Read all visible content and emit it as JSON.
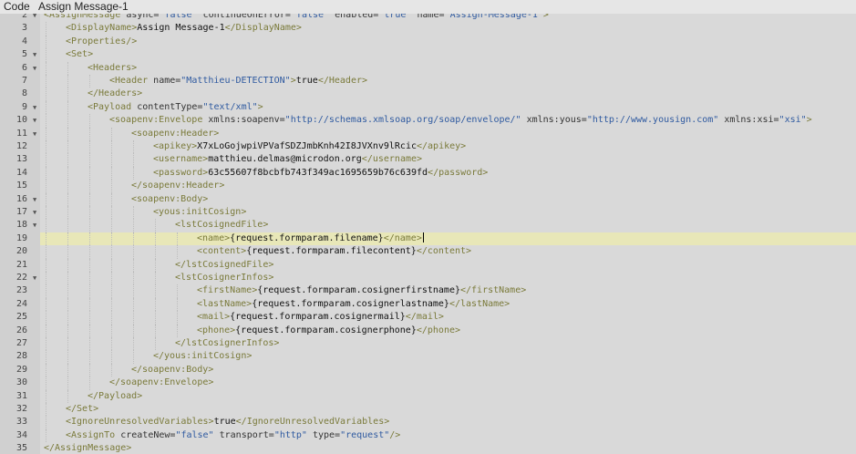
{
  "header": {
    "code_label": "Code",
    "policy_name": "Assign Message-1"
  },
  "editor": {
    "active_line": 19,
    "lines": [
      {
        "n": "2",
        "fold": true,
        "indent": 0,
        "tokens": [
          [
            "tag",
            "<AssignMessage "
          ],
          [
            "attr",
            "async="
          ],
          [
            "str",
            "\"false\""
          ],
          [
            "attr",
            " continueOnError="
          ],
          [
            "str",
            "\"false\""
          ],
          [
            "attr",
            " enabled="
          ],
          [
            "str",
            "\"true\""
          ],
          [
            "attr",
            " name="
          ],
          [
            "str",
            "\"Assign-Message-1\""
          ],
          [
            "tag",
            ">"
          ]
        ]
      },
      {
        "n": "3",
        "fold": false,
        "indent": 1,
        "tokens": [
          [
            "tag",
            "<DisplayName>"
          ],
          [
            "txt",
            "Assign Message-1"
          ],
          [
            "tag",
            "</DisplayName>"
          ]
        ]
      },
      {
        "n": "4",
        "fold": false,
        "indent": 1,
        "tokens": [
          [
            "tag",
            "<Properties/>"
          ]
        ]
      },
      {
        "n": "5",
        "fold": true,
        "indent": 1,
        "tokens": [
          [
            "tag",
            "<Set>"
          ]
        ]
      },
      {
        "n": "6",
        "fold": true,
        "indent": 2,
        "tokens": [
          [
            "tag",
            "<Headers>"
          ]
        ]
      },
      {
        "n": "7",
        "fold": false,
        "indent": 3,
        "tokens": [
          [
            "tag",
            "<Header "
          ],
          [
            "attr",
            "name="
          ],
          [
            "str",
            "\"Matthieu-DETECTION\""
          ],
          [
            "tag",
            ">"
          ],
          [
            "txt",
            "true"
          ],
          [
            "tag",
            "</Header>"
          ]
        ]
      },
      {
        "n": "8",
        "fold": false,
        "indent": 2,
        "tokens": [
          [
            "tag",
            "</Headers>"
          ]
        ]
      },
      {
        "n": "9",
        "fold": true,
        "indent": 2,
        "tokens": [
          [
            "tag",
            "<Payload "
          ],
          [
            "attr",
            "contentType="
          ],
          [
            "str",
            "\"text/xml\""
          ],
          [
            "tag",
            ">"
          ]
        ]
      },
      {
        "n": "10",
        "fold": true,
        "indent": 3,
        "tokens": [
          [
            "tag",
            "<soapenv:Envelope "
          ],
          [
            "attr",
            "xmlns:soapenv="
          ],
          [
            "str",
            "\"http://schemas.xmlsoap.org/soap/envelope/\""
          ],
          [
            "attr",
            " xmlns:yous="
          ],
          [
            "str",
            "\"http://www.yousign.com\""
          ],
          [
            "attr",
            " xmlns:xsi="
          ],
          [
            "str",
            "\"xsi\""
          ],
          [
            "tag",
            ">"
          ]
        ]
      },
      {
        "n": "11",
        "fold": true,
        "indent": 4,
        "tokens": [
          [
            "tag",
            "<soapenv:Header>"
          ]
        ]
      },
      {
        "n": "12",
        "fold": false,
        "indent": 5,
        "tokens": [
          [
            "tag",
            "<apikey>"
          ],
          [
            "txt",
            "X7xLoGojwpiVPVafSDZJmbKnh42I8JVXnv9lRcic"
          ],
          [
            "tag",
            "</apikey>"
          ]
        ]
      },
      {
        "n": "13",
        "fold": false,
        "indent": 5,
        "tokens": [
          [
            "tag",
            "<username>"
          ],
          [
            "txt",
            "matthieu.delmas@microdon.org"
          ],
          [
            "tag",
            "</username>"
          ]
        ]
      },
      {
        "n": "14",
        "fold": false,
        "indent": 5,
        "tokens": [
          [
            "tag",
            "<password>"
          ],
          [
            "txt",
            "63c55607f8bcbfb743f349ac1695659b76c639fd"
          ],
          [
            "tag",
            "</password>"
          ]
        ]
      },
      {
        "n": "15",
        "fold": false,
        "indent": 4,
        "tokens": [
          [
            "tag",
            "</soapenv:Header>"
          ]
        ]
      },
      {
        "n": "16",
        "fold": true,
        "indent": 4,
        "tokens": [
          [
            "tag",
            "<soapenv:Body>"
          ]
        ]
      },
      {
        "n": "17",
        "fold": true,
        "indent": 5,
        "tokens": [
          [
            "tag",
            "<yous:initCosign>"
          ]
        ]
      },
      {
        "n": "18",
        "fold": true,
        "indent": 6,
        "tokens": [
          [
            "tag",
            "<lstCosignedFile>"
          ]
        ]
      },
      {
        "n": "19",
        "fold": false,
        "indent": 7,
        "tokens": [
          [
            "tag",
            "<name>"
          ],
          [
            "txt",
            "{request.formparam.filename}"
          ],
          [
            "tag",
            "</name>"
          ]
        ]
      },
      {
        "n": "20",
        "fold": false,
        "indent": 7,
        "tokens": [
          [
            "tag",
            "<content>"
          ],
          [
            "txt",
            "{request.formparam.filecontent}"
          ],
          [
            "tag",
            "</content>"
          ]
        ]
      },
      {
        "n": "21",
        "fold": false,
        "indent": 6,
        "tokens": [
          [
            "tag",
            "</lstCosignedFile>"
          ]
        ]
      },
      {
        "n": "22",
        "fold": true,
        "indent": 6,
        "tokens": [
          [
            "tag",
            "<lstCosignerInfos>"
          ]
        ]
      },
      {
        "n": "23",
        "fold": false,
        "indent": 7,
        "tokens": [
          [
            "tag",
            "<firstName>"
          ],
          [
            "txt",
            "{request.formparam.cosignerfirstname}"
          ],
          [
            "tag",
            "</firstName>"
          ]
        ]
      },
      {
        "n": "24",
        "fold": false,
        "indent": 7,
        "tokens": [
          [
            "tag",
            "<lastName>"
          ],
          [
            "txt",
            "{request.formparam.cosignerlastname}"
          ],
          [
            "tag",
            "</lastName>"
          ]
        ]
      },
      {
        "n": "25",
        "fold": false,
        "indent": 7,
        "tokens": [
          [
            "tag",
            "<mail>"
          ],
          [
            "txt",
            "{request.formparam.cosignermail}"
          ],
          [
            "tag",
            "</mail>"
          ]
        ]
      },
      {
        "n": "26",
        "fold": false,
        "indent": 7,
        "tokens": [
          [
            "tag",
            "<phone>"
          ],
          [
            "txt",
            "{request.formparam.cosignerphone}"
          ],
          [
            "tag",
            "</phone>"
          ]
        ]
      },
      {
        "n": "27",
        "fold": false,
        "indent": 6,
        "tokens": [
          [
            "tag",
            "</lstCosignerInfos>"
          ]
        ]
      },
      {
        "n": "28",
        "fold": false,
        "indent": 5,
        "tokens": [
          [
            "tag",
            "</yous:initCosign>"
          ]
        ]
      },
      {
        "n": "29",
        "fold": false,
        "indent": 4,
        "tokens": [
          [
            "tag",
            "</soapenv:Body>"
          ]
        ]
      },
      {
        "n": "30",
        "fold": false,
        "indent": 3,
        "tokens": [
          [
            "tag",
            "</soapenv:Envelope>"
          ]
        ]
      },
      {
        "n": "31",
        "fold": false,
        "indent": 2,
        "tokens": [
          [
            "tag",
            "</Payload>"
          ]
        ]
      },
      {
        "n": "32",
        "fold": false,
        "indent": 1,
        "tokens": [
          [
            "tag",
            "</Set>"
          ]
        ]
      },
      {
        "n": "33",
        "fold": false,
        "indent": 1,
        "tokens": [
          [
            "tag",
            "<IgnoreUnresolvedVariables>"
          ],
          [
            "txt",
            "true"
          ],
          [
            "tag",
            "</IgnoreUnresolvedVariables>"
          ]
        ]
      },
      {
        "n": "34",
        "fold": false,
        "indent": 1,
        "tokens": [
          [
            "tag",
            "<AssignTo "
          ],
          [
            "attr",
            "createNew="
          ],
          [
            "str",
            "\"false\""
          ],
          [
            "attr",
            " transport="
          ],
          [
            "str",
            "\"http\""
          ],
          [
            "attr",
            " type="
          ],
          [
            "str",
            "\"request\""
          ],
          [
            "tag",
            "/>"
          ]
        ]
      },
      {
        "n": "35",
        "fold": false,
        "indent": 0,
        "tokens": [
          [
            "tag",
            "</AssignMessage>"
          ]
        ]
      }
    ]
  }
}
